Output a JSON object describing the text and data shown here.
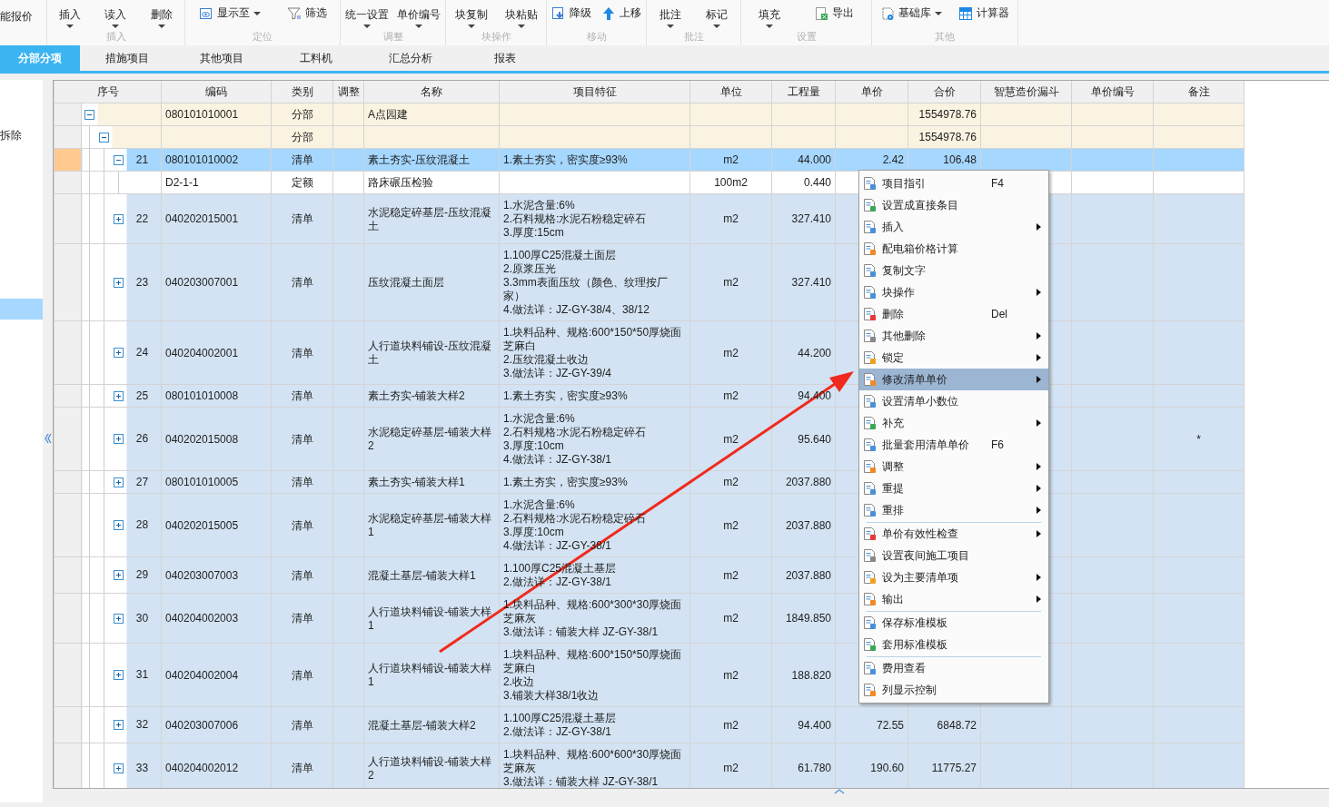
{
  "toolbar": {
    "cut_button": "能报价",
    "groups": [
      {
        "label": "插入",
        "buttons": [
          {
            "label": "插入",
            "kind": "split"
          },
          {
            "label": "读入",
            "kind": "split"
          },
          {
            "label": "删除",
            "kind": "split"
          }
        ]
      },
      {
        "label": "定位",
        "buttons": [
          {
            "label": "显示至",
            "kind": "icon-dropdown"
          },
          {
            "label": "筛选",
            "kind": "icon"
          }
        ]
      },
      {
        "label": "调整",
        "buttons": [
          {
            "label": "统一设置",
            "kind": "split"
          },
          {
            "label": "单价编号",
            "kind": "split"
          }
        ]
      },
      {
        "label": "块操作",
        "buttons": [
          {
            "label": "块复制",
            "kind": "split"
          },
          {
            "label": "块粘贴",
            "kind": "split"
          }
        ]
      },
      {
        "label": "移动",
        "buttons": [
          {
            "label": "降级",
            "kind": "icon"
          },
          {
            "label": "上移",
            "kind": "icon"
          }
        ]
      },
      {
        "label": "批注",
        "buttons": [
          {
            "label": "批注",
            "kind": "split"
          },
          {
            "label": "标记",
            "kind": "split"
          }
        ]
      },
      {
        "label": "设置",
        "buttons": [
          {
            "label": "填充",
            "kind": "split"
          },
          {
            "label": "导出",
            "kind": "icon"
          }
        ]
      },
      {
        "label": "其他",
        "buttons": [
          {
            "label": "基础库",
            "kind": "icon-dropdown"
          },
          {
            "label": "计算器",
            "kind": "icon"
          }
        ]
      }
    ]
  },
  "tabs": [
    {
      "label": "分部分项",
      "selected": true
    },
    {
      "label": "措施项目",
      "selected": false
    },
    {
      "label": "其他项目",
      "selected": false
    },
    {
      "label": "工料机",
      "selected": false
    },
    {
      "label": "汇总分析",
      "selected": false
    },
    {
      "label": "报表",
      "selected": false
    }
  ],
  "sidebar": {
    "items": [
      {
        "label": "拆除",
        "selected": false
      },
      {
        "selected": true
      }
    ]
  },
  "table": {
    "columns": [
      "序号",
      "编码",
      "类别",
      "调整",
      "名称",
      "项目特征",
      "单位",
      "工程量",
      "单价",
      "合价",
      "智慧造价漏斗",
      "单价编号",
      "备注"
    ],
    "rows": [
      {
        "kind": "division",
        "selected": false,
        "expanded": true,
        "code": "080101010001",
        "category": "分部",
        "name": "A点园建",
        "total": "1554978.76",
        "children": [
          {
            "kind": "division",
            "selected": false,
            "expanded": true,
            "category": "分部",
            "total": "1554978.76",
            "children": [
              {
                "kind": "bill",
                "selected": true,
                "expanded": true,
                "number": "21",
                "code": "080101010002",
                "category": "清单",
                "name": "素土夯实-压纹混凝土",
                "features": [
                  "1.素土夯实，密实度≥93%"
                ],
                "unit": "m2",
                "quantity": "44.000",
                "unit_price": "2.42",
                "total": "106.48",
                "children": [
                  {
                    "kind": "quota",
                    "selected": false,
                    "code": "D2-1-1",
                    "category": "定额",
                    "name": "路床碾压检验",
                    "unit": "100m2",
                    "quantity": "0.440"
                  }
                ]
              },
              {
                "kind": "bill",
                "selected": false,
                "expanded": false,
                "number": "22",
                "code": "040202015001",
                "category": "清单",
                "name": "水泥稳定碎基层-压纹混凝土",
                "features": [
                  "1.水泥含量:6%",
                  "2.石料规格:水泥石粉稳定碎石",
                  "3.厚度:15cm"
                ],
                "unit": "m2",
                "quantity": "327.410"
              },
              {
                "kind": "bill",
                "selected": false,
                "expanded": false,
                "number": "23",
                "code": "040203007001",
                "category": "清单",
                "name": "压纹混凝土面层",
                "features": [
                  "1.100厚C25混凝土面层",
                  "2.原浆压光",
                  "3.3mm表面压纹（颜色、纹理按厂家）",
                  "4.做法详：JZ-GY-38/4、38/12"
                ],
                "unit": "m2",
                "quantity": "327.410"
              },
              {
                "kind": "bill",
                "selected": false,
                "expanded": false,
                "number": "24",
                "code": "040204002001",
                "category": "清单",
                "name": "人行道块料铺设-压纹混凝土",
                "features": [
                  "1.块料品种、规格:600*150*50厚烧面芝麻白",
                  "2.压纹混凝土收边",
                  "3.做法详：JZ-GY-39/4"
                ],
                "unit": "m2",
                "quantity": "44.200"
              },
              {
                "kind": "bill",
                "selected": false,
                "expanded": false,
                "number": "25",
                "code": "080101010008",
                "category": "清单",
                "name": "素土夯实-铺装大样2",
                "features": [
                  "1.素土夯实，密实度≥93%"
                ],
                "unit": "m2",
                "quantity": "94.400"
              },
              {
                "kind": "bill",
                "selected": false,
                "expanded": false,
                "number": "26",
                "code": "040202015008",
                "category": "清单",
                "name": "水泥稳定碎基层-铺装大样2",
                "features": [
                  "1.水泥含量:6%",
                  "2.石料规格:水泥石粉稳定碎石",
                  "3.厚度:10cm",
                  "4.做法详：JZ-GY-38/1"
                ],
                "unit": "m2",
                "quantity": "95.640",
                "remark": "*"
              },
              {
                "kind": "bill",
                "selected": false,
                "expanded": false,
                "number": "27",
                "code": "080101010005",
                "category": "清单",
                "name": "素土夯实-铺装大样1",
                "features": [
                  "1.素土夯实，密实度≥93%"
                ],
                "unit": "m2",
                "quantity": "2037.880"
              },
              {
                "kind": "bill",
                "selected": false,
                "expanded": false,
                "number": "28",
                "code": "040202015005",
                "category": "清单",
                "name": "水泥稳定碎基层-铺装大样1",
                "features": [
                  "1.水泥含量:6%",
                  "2.石料规格:水泥石粉稳定碎石",
                  "3.厚度:10cm",
                  "4.做法详：JZ-GY-38/1"
                ],
                "unit": "m2",
                "quantity": "2037.880"
              },
              {
                "kind": "bill",
                "selected": false,
                "expanded": false,
                "number": "29",
                "code": "040203007003",
                "category": "清单",
                "name": "混凝土基层-铺装大样1",
                "features": [
                  "1.100厚C25混凝土基层",
                  "2.做法详：JZ-GY-38/1"
                ],
                "unit": "m2",
                "quantity": "2037.880"
              },
              {
                "kind": "bill",
                "selected": false,
                "expanded": false,
                "number": "30",
                "code": "040204002003",
                "category": "清单",
                "name": "人行道块料铺设-铺装大样1",
                "features": [
                  "1.块料品种、规格:600*300*30厚烧面芝麻灰",
                  "3.做法详：铺装大样 JZ-GY-38/1"
                ],
                "unit": "m2",
                "quantity": "1849.850"
              },
              {
                "kind": "bill",
                "selected": false,
                "expanded": false,
                "number": "31",
                "code": "040204002004",
                "category": "清单",
                "name": "人行道块料铺设-铺装大样1",
                "features": [
                  "1.块料品种、规格:600*150*50厚烧面芝麻白",
                  "2.收边",
                  "3.铺装大样38/1收边"
                ],
                "unit": "m2",
                "quantity": "188.820"
              },
              {
                "kind": "bill",
                "selected": false,
                "expanded": false,
                "number": "32",
                "code": "040203007006",
                "category": "清单",
                "name": "混凝土基层-铺装大样2",
                "features": [
                  "1.100厚C25混凝土基层",
                  "2.做法详：JZ-GY-38/1"
                ],
                "unit": "m2",
                "quantity": "94.400",
                "unit_price": "72.55",
                "total": "6848.72"
              },
              {
                "kind": "bill",
                "selected": false,
                "expanded": false,
                "number": "33",
                "code": "040204002012",
                "category": "清单",
                "name": "人行道块料铺设-铺装大样2",
                "features": [
                  "1.块料品种、规格:600*600*30厚烧面芝麻灰",
                  "3.做法详：铺装大样 JZ-GY-38/1"
                ],
                "unit": "m2",
                "quantity": "61.780",
                "unit_price": "190.60",
                "total": "11775.27"
              }
            ]
          }
        ]
      }
    ]
  },
  "context_menu": {
    "items": [
      {
        "kind": "item",
        "label": "项目指引",
        "shortcut": "F4",
        "submenu": false,
        "selected": false
      },
      {
        "kind": "item",
        "label": "设置成直接条目",
        "submenu": false,
        "selected": false
      },
      {
        "kind": "item",
        "label": "插入",
        "submenu": true,
        "selected": false
      },
      {
        "kind": "item",
        "label": "配电箱价格计算",
        "submenu": false,
        "selected": false
      },
      {
        "kind": "item",
        "label": "复制文字",
        "submenu": false,
        "selected": false
      },
      {
        "kind": "item",
        "label": "块操作",
        "submenu": true,
        "selected": false
      },
      {
        "kind": "item",
        "label": "删除",
        "shortcut": "Del",
        "submenu": false,
        "selected": false
      },
      {
        "kind": "item",
        "label": "其他删除",
        "submenu": true,
        "selected": false
      },
      {
        "kind": "item",
        "label": "锁定",
        "submenu": true,
        "selected": false
      },
      {
        "kind": "item",
        "label": "修改清单单价",
        "submenu": true,
        "selected": true
      },
      {
        "kind": "item",
        "label": "设置清单小数位",
        "submenu": false,
        "selected": false
      },
      {
        "kind": "item",
        "label": "补充",
        "submenu": true,
        "selected": false
      },
      {
        "kind": "item",
        "label": "批量套用清单单价",
        "shortcut": "F6",
        "submenu": false,
        "selected": false
      },
      {
        "kind": "item",
        "label": "调整",
        "submenu": true,
        "selected": false
      },
      {
        "kind": "item",
        "label": "重提",
        "submenu": true,
        "selected": false
      },
      {
        "kind": "item",
        "label": "重排",
        "submenu": true,
        "selected": false
      },
      {
        "kind": "separator"
      },
      {
        "kind": "item",
        "label": "单价有效性检查",
        "submenu": true,
        "selected": false
      },
      {
        "kind": "item",
        "label": "设置夜间施工项目",
        "submenu": false,
        "selected": false
      },
      {
        "kind": "item",
        "label": "设为主要清单项",
        "submenu": true,
        "selected": false
      },
      {
        "kind": "item",
        "label": "输出",
        "submenu": true,
        "selected": false
      },
      {
        "kind": "separator"
      },
      {
        "kind": "item",
        "label": "保存标准模板",
        "submenu": false,
        "selected": false
      },
      {
        "kind": "item",
        "label": "套用标准模板",
        "submenu": false,
        "selected": false
      },
      {
        "kind": "separator"
      },
      {
        "kind": "item",
        "label": "费用查看",
        "submenu": false,
        "selected": false
      },
      {
        "kind": "item",
        "label": "列显示控制",
        "submenu": false,
        "selected": false
      }
    ]
  }
}
